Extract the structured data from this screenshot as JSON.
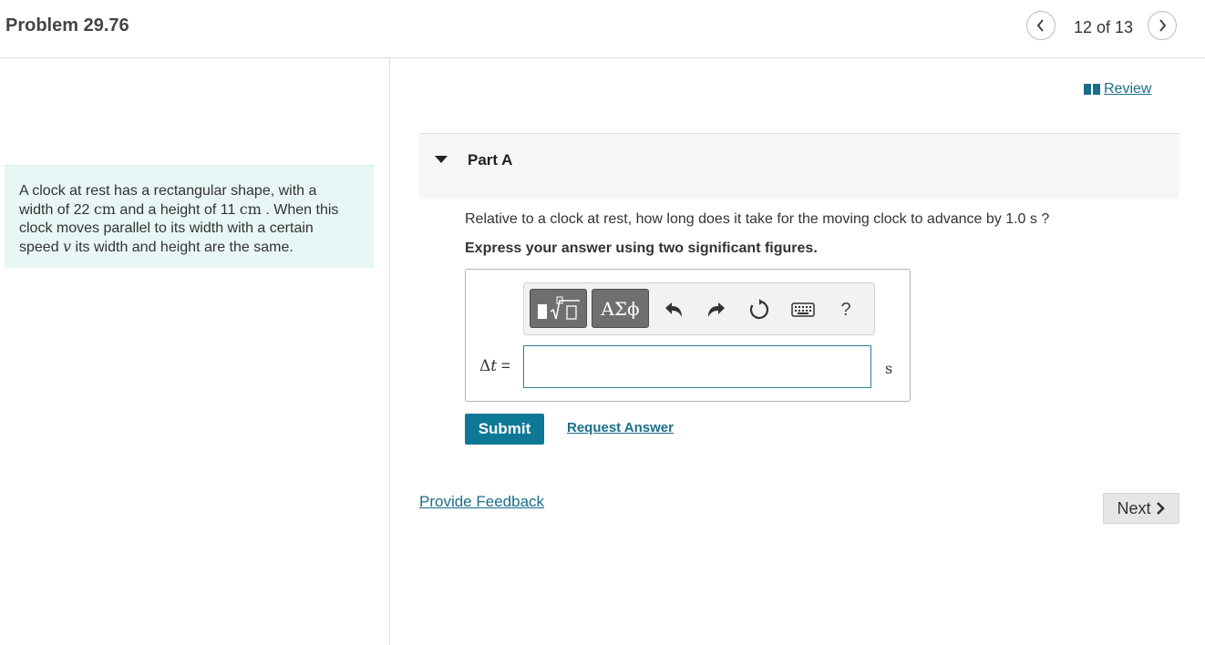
{
  "header": {
    "title": "Problem 29.76",
    "counter": "12 of 13",
    "prev_icon": "chevron-left-icon",
    "next_icon": "chevron-right-icon"
  },
  "intro": {
    "line1": "A clock at rest has a rectangular shape, with a",
    "l2_a": "width of 22 ",
    "l2_unit": "cm",
    "l2_b": " and a height of 11 ",
    "l2_unit2": "cm",
    "l2_c": " . When this",
    "line3": "clock moves parallel to its width with a certain",
    "l4_a": "speed ",
    "l4_var": "v",
    "l4_b": " its width and height are the same."
  },
  "review": {
    "label": "Review",
    "icon": "book-icon"
  },
  "part": {
    "label": "Part A",
    "icon": "caret-down-icon"
  },
  "question": {
    "text": "Relative to a clock at rest, how long does it take for the moving clock to advance by 1.0 s ?",
    "instruction": "Express your answer using two significant figures."
  },
  "toolbar": {
    "templates_icon": "math-templates-icon",
    "symbols_label": "ΑΣϕ",
    "undo_icon": "undo-icon",
    "redo_icon": "redo-icon",
    "reset_icon": "reset-icon",
    "keyboard_icon": "keyboard-icon",
    "help_label": "?"
  },
  "answer": {
    "delta": "Δ",
    "var": "t",
    "eq": " =",
    "value": "",
    "unit": "s"
  },
  "actions": {
    "submit": "Submit",
    "request": "Request Answer",
    "feedback": "Provide Feedback",
    "next": "Next"
  },
  "colors": {
    "accent": "#0e7897",
    "link": "#1a6e8a",
    "intro_bg": "#e8f6f6"
  }
}
